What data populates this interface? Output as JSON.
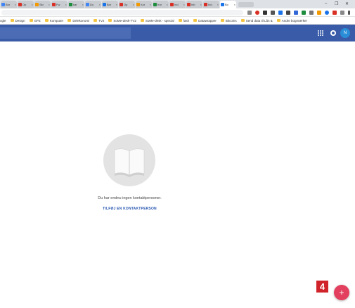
{
  "browser": {
    "tabs": [
      {
        "label": "Bor",
        "color": "#4285f4"
      },
      {
        "label": "Op",
        "color": "#d93025"
      },
      {
        "label": "Skr",
        "color": "#f29900"
      },
      {
        "label": "Fw",
        "color": "#d93025"
      },
      {
        "label": "kar",
        "color": "#1e8e3e"
      },
      {
        "label": "Do",
        "color": "#4285f4"
      },
      {
        "label": "Bor",
        "color": "#1a73e8"
      },
      {
        "label": "Op",
        "color": "#d93025"
      },
      {
        "label": "Kor",
        "color": "#f29900"
      },
      {
        "label": "fror",
        "color": "#1e8e3e"
      },
      {
        "label": "Ind",
        "color": "#d93025"
      },
      {
        "label": "Inb",
        "color": "#d93025"
      },
      {
        "label": "Ind",
        "color": "#d93025"
      },
      {
        "label": "Bo",
        "color": "#1a73e8",
        "active": true
      }
    ],
    "tab_close": "×",
    "window_controls": {
      "minimize": "–",
      "restore": "❐",
      "close": "✕"
    },
    "bookmarks": [
      {
        "label": "ogle"
      },
      {
        "label": "Design"
      },
      {
        "label": "GPZ"
      },
      {
        "label": "Komputer"
      },
      {
        "label": "Delekonomi"
      },
      {
        "label": "TV2"
      },
      {
        "label": "SoMe-desk-TV2"
      },
      {
        "label": "SoMe-desk - special"
      },
      {
        "label": "fash"
      },
      {
        "label": "Datawrapper"
      },
      {
        "label": "Bitcoins"
      },
      {
        "label": "Send data til Lån &"
      },
      {
        "label": "Andre bogmærker"
      }
    ]
  },
  "app": {
    "header_color": "#3a5ba8",
    "avatar_initial": "N",
    "empty_state": {
      "message": "Du har endnu ingen kontaktpersoner.",
      "action_label": "TILFØJ EN KONTAKTPERSON"
    },
    "fab_symbol": "+"
  },
  "annotation": {
    "step_number": "4"
  }
}
